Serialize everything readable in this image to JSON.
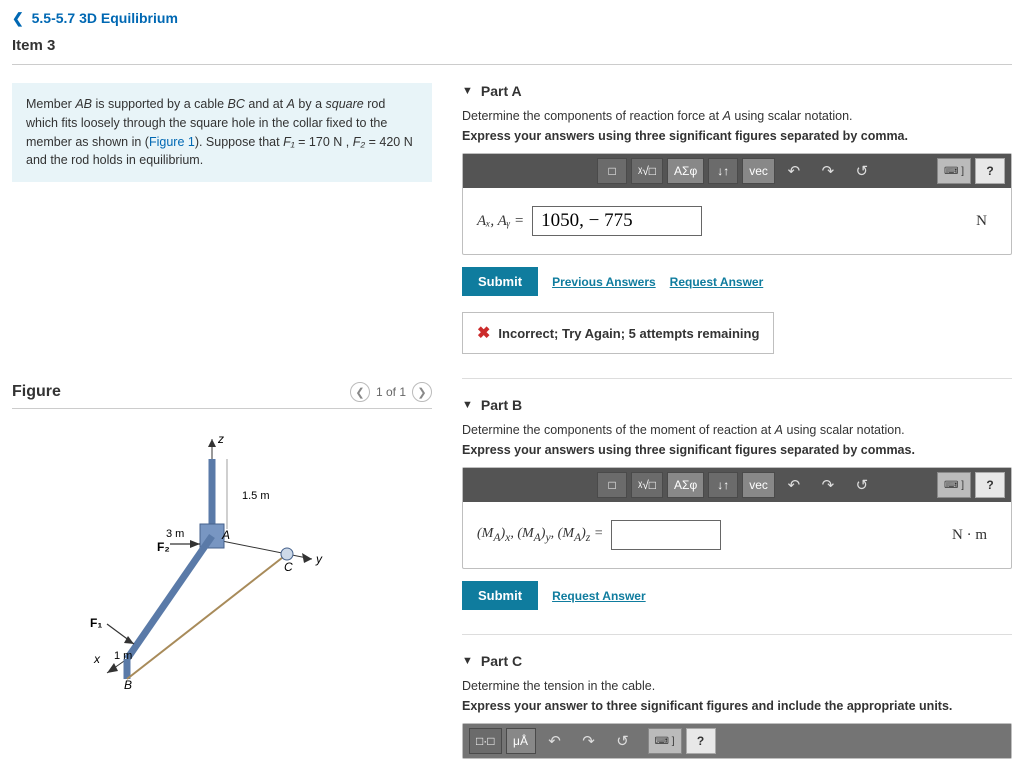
{
  "nav": {
    "breadcrumb": "5.5-5.7 3D Equilibrium",
    "item": "Item 3"
  },
  "intro": {
    "l1a": "Member ",
    "ab": "AB",
    "l1b": " is supported by a cable ",
    "bc": "BC",
    "l1c": " and at ",
    "a": "A",
    "l1d": " by a ",
    "sq": "square",
    "l1e": " rod which fits loosely through the square hole in the collar fixed to the member as shown in (",
    "figref": "Figure 1",
    "l2": "). Suppose that ",
    "f1": "F₁",
    "eq1": " = 170  N , ",
    "f2": "F₂",
    "eq2": " = 420  N and the rod holds in equilibrium."
  },
  "figure": {
    "title": "Figure",
    "pager": "1 of 1",
    "labels": {
      "z": "z",
      "y": "y",
      "x": "x",
      "a": "A",
      "b": "B",
      "c": "C",
      "f1": "F₁",
      "f2": "F₂",
      "d1": "1.5 m",
      "d2": "3 m",
      "d3": "1 m"
    }
  },
  "toolbar": {
    "template": "□",
    "sqrtx": "ᵡ√□",
    "greek": "ΑΣφ",
    "subsuper": "↓↑",
    "vec": "vec",
    "undo": "↶",
    "redo": "↷",
    "reset": "↺",
    "keyboard": "⌨ ]",
    "help": "?",
    "units1": "□·□",
    "units2": "μÅ"
  },
  "partA": {
    "title": "Part A",
    "prompt1a": "Determine the components of reaction force at ",
    "promptA": "A",
    "prompt1b": " using scalar notation.",
    "prompt2": "Express your answers using three significant figures separated by comma.",
    "label": "Aₓ, Aᵧ =",
    "value": "1050, − 775",
    "unit": "N",
    "submit": "Submit",
    "prev": "Previous Answers",
    "req": "Request Answer",
    "feedback": "Incorrect; Try Again; 5 attempts remaining"
  },
  "partB": {
    "title": "Part B",
    "prompt1a": "Determine the components of the moment of reaction at ",
    "promptA": "A",
    "prompt1b": " using scalar notation.",
    "prompt2": "Express your answers using three significant figures separated by commas.",
    "label": "(M_A)ₓ, (M_A)ᵧ, (M_A)_z =",
    "value": "",
    "unit": "N · m",
    "submit": "Submit",
    "req": "Request Answer"
  },
  "partC": {
    "title": "Part C",
    "prompt1": "Determine the tension in the cable.",
    "prompt2": "Express your answer to three significant figures and include the appropriate units."
  }
}
